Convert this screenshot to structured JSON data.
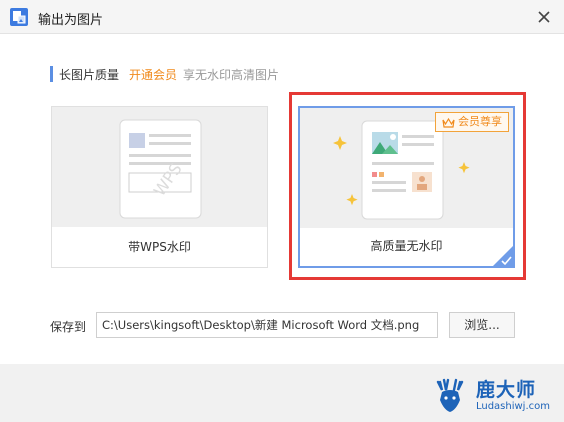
{
  "window": {
    "title": "输出为图片",
    "icons": {
      "app": "image-export-icon",
      "close": "close-icon"
    }
  },
  "quality": {
    "label": "长图片质量",
    "vip_link": "开通会员",
    "vip_desc": "享无水印高清图片"
  },
  "options": [
    {
      "label": "带WPS水印",
      "selected": false,
      "icon": "document-watermark-icon"
    },
    {
      "label": "高质量无水印",
      "selected": true,
      "badge": "会员尊享",
      "badge_icon": "crown-icon",
      "icon": "document-image-icon"
    }
  ],
  "save": {
    "label": "保存到",
    "path": "C:\\Users\\kingsoft\\Desktop\\新建 Microsoft Word 文档.png",
    "browse_label": "浏览..."
  },
  "watermark": {
    "title": "鹿大师",
    "url": "Ludashiwj.com"
  },
  "colors": {
    "accent": "#5b8fe3",
    "vip": "#f08a1c",
    "highlight": "#e53935",
    "brand": "#1d63b8"
  }
}
